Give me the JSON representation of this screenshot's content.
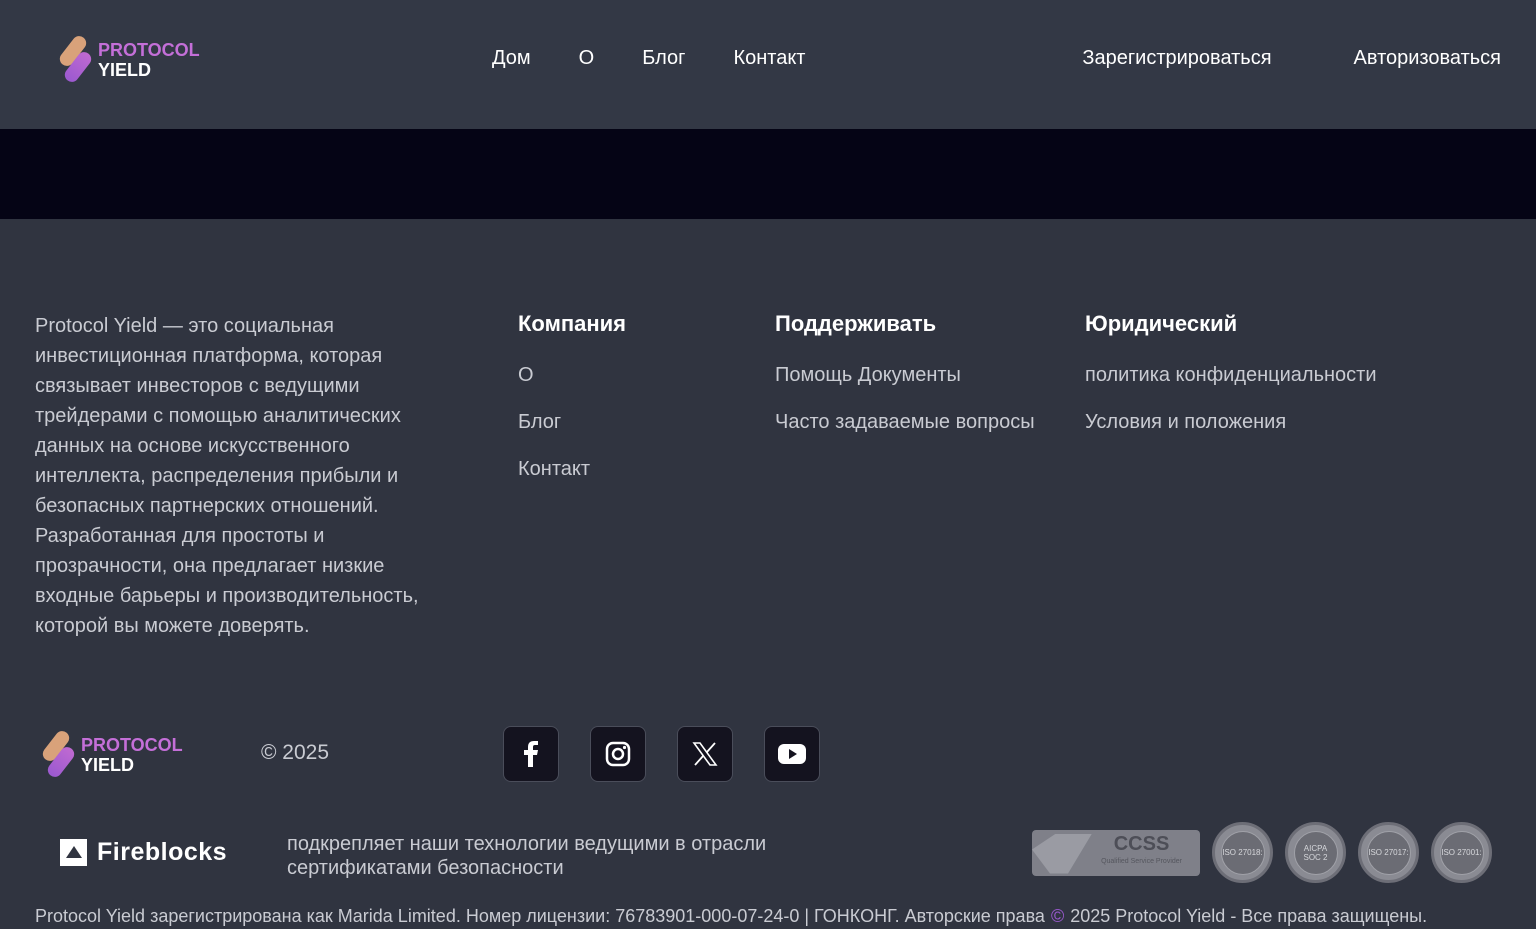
{
  "brand": {
    "line1": "PROTOCOL",
    "line2": "YIELD"
  },
  "nav": {
    "items": [
      "Дом",
      "О",
      "Блог",
      "Контакт"
    ]
  },
  "auth": {
    "register": "Зарегистрироваться",
    "login": "Авторизоваться"
  },
  "footer": {
    "about": "Protocol Yield — это социальная инвестиционная платформа, которая связывает инвесторов с ведущими трейдерами с помощью аналитических данных на основе искусственного интеллекта, распределения прибыли и безопасных партнерских отношений. Разработанная для простоты и прозрачности, она предлагает низкие входные барьеры и производительность, которой вы можете доверять.",
    "columns": [
      {
        "title": "Компания",
        "links": [
          "О",
          "Блог",
          "Контакт"
        ]
      },
      {
        "title": "Поддерживать",
        "links": [
          "Помощь Документы",
          "Часто задаваемые вопросы"
        ]
      },
      {
        "title": "Юридический",
        "links": [
          "политика конфиденциальности",
          "Условия и положения"
        ]
      }
    ],
    "copyright": "© 2025",
    "social": [
      "facebook-icon",
      "instagram-icon",
      "x-icon",
      "youtube-icon"
    ],
    "fireblocks": {
      "name": "Fireblocks",
      "text": "подкрепляет наши технологии ведущими в отрасли сертификатами безопасности"
    },
    "certs": {
      "ccss": {
        "title": "CCSS",
        "subtitle": "Qualified Service Provider"
      },
      "seals": [
        "ISO 27018:",
        "AICPA SOC 2",
        "ISO 27017:",
        "ISO 27001:"
      ]
    },
    "legal_left": "Protocol Yield зарегистрирована как Marida Limited. Номер лицензии: 76783901-000-07-24-0 | ГОНКОНГ. Авторские права",
    "legal_symbol": "©",
    "legal_right": "2025 Protocol Yield - Все права защищены."
  }
}
